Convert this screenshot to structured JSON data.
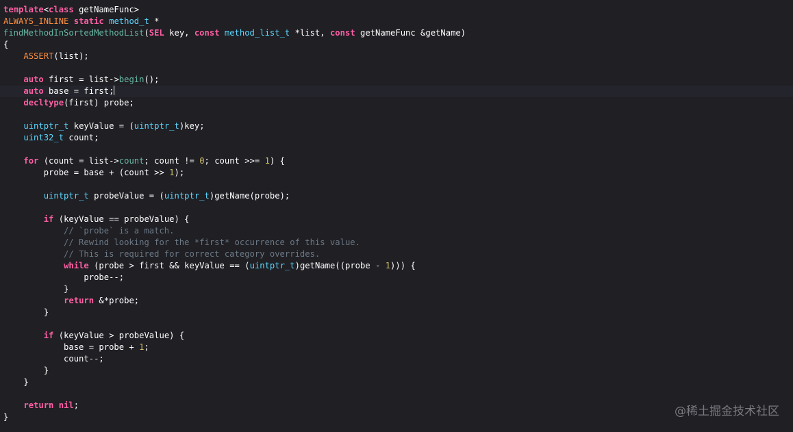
{
  "watermark": "@稀土掘金技术社区",
  "lines": [
    [
      [
        "kw",
        "template"
      ],
      [
        "pl",
        "<"
      ],
      [
        "kw",
        "class"
      ],
      [
        "pl",
        " getNameFunc>"
      ]
    ],
    [
      [
        "mac",
        "ALWAYS_INLINE"
      ],
      [
        "pl",
        " "
      ],
      [
        "kw",
        "static"
      ],
      [
        "pl",
        " "
      ],
      [
        "ty",
        "method_t"
      ],
      [
        "pl",
        " *"
      ]
    ],
    [
      [
        "fn",
        "findMethodInSortedMethodList"
      ],
      [
        "pl",
        "("
      ],
      [
        "kw",
        "SEL"
      ],
      [
        "pl",
        " key, "
      ],
      [
        "kw",
        "const"
      ],
      [
        "pl",
        " "
      ],
      [
        "ty",
        "method_list_t"
      ],
      [
        "pl",
        " *list, "
      ],
      [
        "kw",
        "const"
      ],
      [
        "pl",
        " getNameFunc &getName)"
      ]
    ],
    [
      [
        "pl",
        "{"
      ]
    ],
    [
      [
        "pl",
        "    "
      ],
      [
        "mac",
        "ASSERT"
      ],
      [
        "pl",
        "(list);"
      ]
    ],
    [],
    [
      [
        "pl",
        "    "
      ],
      [
        "kw",
        "auto"
      ],
      [
        "pl",
        " first = list->"
      ],
      [
        "fn",
        "begin"
      ],
      [
        "pl",
        "();"
      ]
    ],
    [
      [
        "pl",
        "    "
      ],
      [
        "kw",
        "auto"
      ],
      [
        "pl",
        " base = first;"
      ]
    ],
    [
      [
        "pl",
        "    "
      ],
      [
        "kw",
        "decltype"
      ],
      [
        "pl",
        "(first) probe;"
      ]
    ],
    [],
    [
      [
        "pl",
        "    "
      ],
      [
        "ty",
        "uintptr_t"
      ],
      [
        "pl",
        " keyValue = ("
      ],
      [
        "ty",
        "uintptr_t"
      ],
      [
        "pl",
        ")key;"
      ]
    ],
    [
      [
        "pl",
        "    "
      ],
      [
        "ty",
        "uint32_t"
      ],
      [
        "pl",
        " count;"
      ]
    ],
    [],
    [
      [
        "pl",
        "    "
      ],
      [
        "kw",
        "for"
      ],
      [
        "pl",
        " (count = list->"
      ],
      [
        "fn",
        "count"
      ],
      [
        "pl",
        "; count != "
      ],
      [
        "num",
        "0"
      ],
      [
        "pl",
        "; count >>= "
      ],
      [
        "num",
        "1"
      ],
      [
        "pl",
        ") {"
      ]
    ],
    [
      [
        "pl",
        "        probe = base + (count >> "
      ],
      [
        "num",
        "1"
      ],
      [
        "pl",
        ");"
      ]
    ],
    [],
    [
      [
        "pl",
        "        "
      ],
      [
        "ty",
        "uintptr_t"
      ],
      [
        "pl",
        " probeValue = ("
      ],
      [
        "ty",
        "uintptr_t"
      ],
      [
        "pl",
        ")getName(probe);"
      ]
    ],
    [],
    [
      [
        "pl",
        "        "
      ],
      [
        "kw",
        "if"
      ],
      [
        "pl",
        " (keyValue == probeValue) {"
      ]
    ],
    [
      [
        "cm",
        "            // `probe` is a match."
      ]
    ],
    [
      [
        "cm",
        "            // Rewind looking for the *first* occurrence of this value."
      ]
    ],
    [
      [
        "cm",
        "            // This is required for correct category overrides."
      ]
    ],
    [
      [
        "pl",
        "            "
      ],
      [
        "kw",
        "while"
      ],
      [
        "pl",
        " (probe > first && keyValue == ("
      ],
      [
        "ty",
        "uintptr_t"
      ],
      [
        "pl",
        ")getName((probe - "
      ],
      [
        "num",
        "1"
      ],
      [
        "pl",
        "))) {"
      ]
    ],
    [
      [
        "pl",
        "                probe--;"
      ]
    ],
    [
      [
        "pl",
        "            }"
      ]
    ],
    [
      [
        "pl",
        "            "
      ],
      [
        "kw",
        "return"
      ],
      [
        "pl",
        " &*probe;"
      ]
    ],
    [
      [
        "pl",
        "        }"
      ]
    ],
    [],
    [
      [
        "pl",
        "        "
      ],
      [
        "kw",
        "if"
      ],
      [
        "pl",
        " (keyValue > probeValue) {"
      ]
    ],
    [
      [
        "pl",
        "            base = probe + "
      ],
      [
        "num",
        "1"
      ],
      [
        "pl",
        ";"
      ]
    ],
    [
      [
        "pl",
        "            count--;"
      ]
    ],
    [
      [
        "pl",
        "        }"
      ]
    ],
    [
      [
        "pl",
        "    }"
      ]
    ],
    [],
    [
      [
        "pl",
        "    "
      ],
      [
        "kw",
        "return"
      ],
      [
        "pl",
        " "
      ],
      [
        "kw",
        "nil"
      ],
      [
        "pl",
        ";"
      ]
    ],
    [
      [
        "pl",
        "}"
      ]
    ]
  ],
  "current_line": 7
}
